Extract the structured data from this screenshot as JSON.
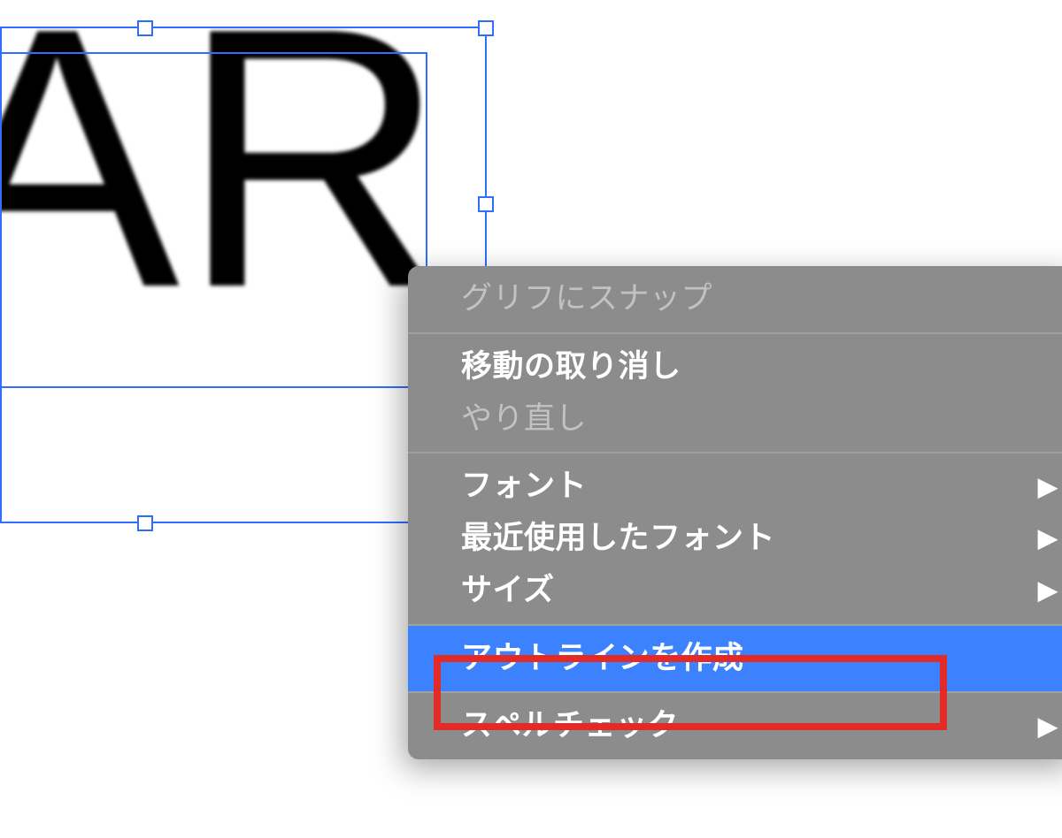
{
  "canvas": {
    "text": "TAR"
  },
  "contextMenu": {
    "items": [
      {
        "label": "グリフにスナップ",
        "disabled": true,
        "submenu": false
      },
      {
        "label": "移動の取り消し",
        "disabled": false,
        "submenu": false
      },
      {
        "label": "やり直し",
        "disabled": true,
        "submenu": false
      },
      {
        "label": "フォント",
        "disabled": false,
        "submenu": true
      },
      {
        "label": "最近使用したフォント",
        "disabled": false,
        "submenu": true
      },
      {
        "label": "サイズ",
        "disabled": false,
        "submenu": true
      },
      {
        "label": "アウトラインを作成",
        "disabled": false,
        "submenu": false,
        "selected": true,
        "annotated": true
      },
      {
        "label": "スペルチェック",
        "disabled": false,
        "submenu": true
      }
    ],
    "arrowGlyph": "▶"
  },
  "colors": {
    "selection": "#2f6fff",
    "menuBg": "#8c8c8c",
    "highlight": "#3c82ff",
    "annotation": "#e22b27"
  }
}
